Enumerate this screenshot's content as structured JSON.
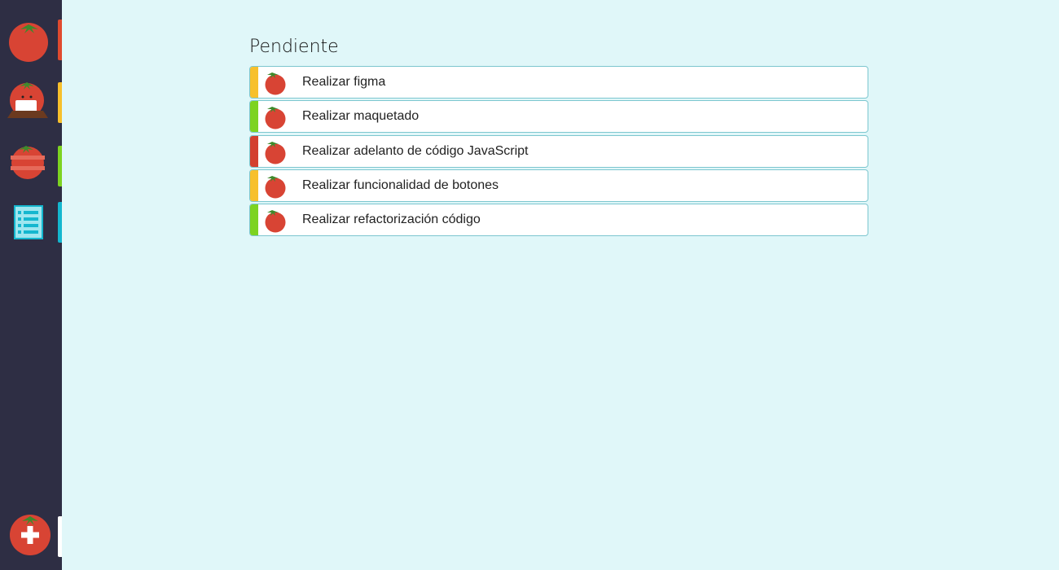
{
  "sidebar": {
    "items": [
      {
        "name": "pomodoro",
        "icon": "tomato-icon",
        "color": "#e04a2f"
      },
      {
        "name": "focus",
        "icon": "tomato-laptop-icon",
        "color": "#f7c02c"
      },
      {
        "name": "stack",
        "icon": "tomato-stack-icon",
        "color": "#7dd321"
      },
      {
        "name": "list",
        "icon": "list-icon",
        "color": "#14b7cf"
      }
    ],
    "add": {
      "icon": "tomato-add-icon",
      "color": "#ffffff"
    }
  },
  "main": {
    "title": "Pendiente",
    "tasks": [
      {
        "label": "Realizar figma",
        "priority_color": "#f7c02c"
      },
      {
        "label": "Realizar maquetado",
        "priority_color": "#7dd321"
      },
      {
        "label": "Realizar adelanto de código  JavaScript",
        "priority_color": "#d33f2f"
      },
      {
        "label": "Realizar funcionalidad de botones",
        "priority_color": "#f7c02c"
      },
      {
        "label": "Realizar refactorización código",
        "priority_color": "#7dd321"
      }
    ]
  },
  "colors": {
    "background": "#e0f7f9",
    "sidebar": "#2e2e44",
    "tomato": "#d84434",
    "leaf": "#3f8a2c"
  }
}
